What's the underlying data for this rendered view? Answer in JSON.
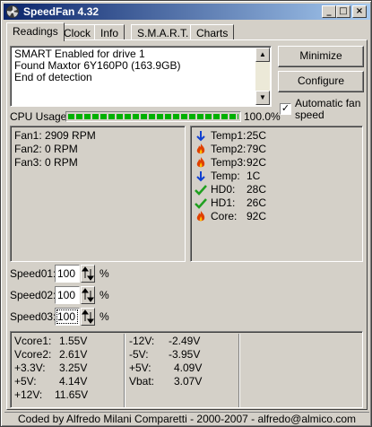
{
  "window": {
    "title": "SpeedFan 4.32"
  },
  "titlebar_buttons": {
    "minimize": "_",
    "maximize": "□",
    "close": "×"
  },
  "tabs": [
    {
      "label": "Readings",
      "active": true
    },
    {
      "label": "Clock",
      "active": false
    },
    {
      "label": "Info",
      "active": false
    },
    {
      "label": "S.M.A.R.T.",
      "active": false
    },
    {
      "label": "Charts",
      "active": false
    }
  ],
  "log": {
    "lines": [
      "SMART Enabled for drive 1",
      "Found Maxtor 6Y160P0 (163.9GB)",
      "End of detection"
    ]
  },
  "buttons": {
    "minimize": "Minimize",
    "configure": "Configure"
  },
  "auto_fan": {
    "label_line1": "Automatic fan",
    "label_line2": "speed",
    "checked": true
  },
  "cpu": {
    "label": "CPU Usage",
    "percent_text": "100.0%",
    "value": 100
  },
  "fans": [
    {
      "name": "Fan1:",
      "value": "2909 RPM"
    },
    {
      "name": "Fan2:",
      "value": "0 RPM"
    },
    {
      "name": "Fan3:",
      "value": "0 RPM"
    }
  ],
  "temps": [
    {
      "name": "Temp1:",
      "value": "25C",
      "icon": "arrow-down-icon"
    },
    {
      "name": "Temp2:",
      "value": "79C",
      "icon": "flame-icon"
    },
    {
      "name": "Temp3:",
      "value": "92C",
      "icon": "flame-icon"
    },
    {
      "name": "Temp:",
      "value": "1C",
      "icon": "arrow-down-icon"
    },
    {
      "name": "HD0:",
      "value": "28C",
      "icon": "checkmark-icon"
    },
    {
      "name": "HD1:",
      "value": "26C",
      "icon": "checkmark-icon"
    },
    {
      "name": "Core:",
      "value": "92C",
      "icon": "flame-icon"
    }
  ],
  "speeds": [
    {
      "label": "Speed01:",
      "value": "100",
      "unit": "%"
    },
    {
      "label": "Speed02:",
      "value": "100",
      "unit": "%"
    },
    {
      "label": "Speed03:",
      "value": "100",
      "unit": "%"
    }
  ],
  "voltages": {
    "col1": [
      {
        "name": "Vcore1:",
        "value": "1.55V"
      },
      {
        "name": "Vcore2:",
        "value": "2.61V"
      },
      {
        "name": "+3.3V:",
        "value": "3.25V"
      },
      {
        "name": "+5V:",
        "value": "4.14V"
      },
      {
        "name": "+12V:",
        "value": "11.65V"
      }
    ],
    "col2": [
      {
        "name": "-12V:",
        "value": "-2.49V"
      },
      {
        "name": "-5V:",
        "value": "-3.95V"
      },
      {
        "name": "+5V:",
        "value": "4.09V"
      },
      {
        "name": "Vbat:",
        "value": "3.07V"
      }
    ]
  },
  "status": {
    "text": "Coded by Alfredo Milani Comparetti - 2000-2007 - alfredo@almico.com"
  },
  "colors": {
    "title_start": "#0a246a",
    "title_end": "#a6caf0",
    "cpu_bar": "#00b000",
    "cold_arrow": "#1040d0",
    "flame": "#e04000",
    "check": "#20a020"
  }
}
